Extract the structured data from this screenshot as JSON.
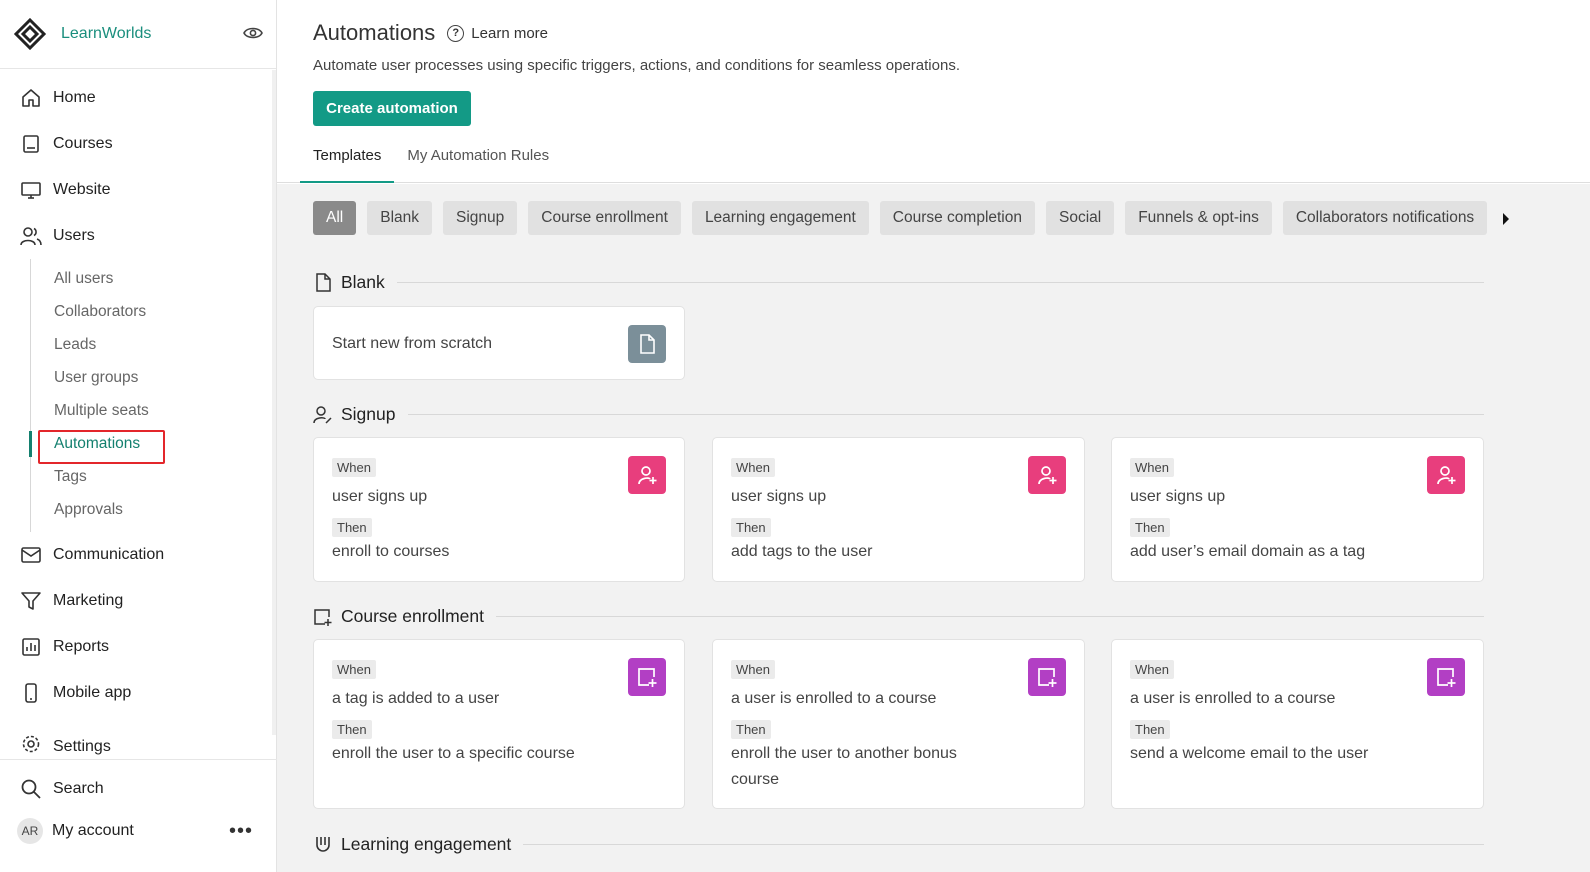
{
  "brand": {
    "name": "LearnWorlds",
    "logo_icon": "logo-icon",
    "view_icon": "eye-icon"
  },
  "nav": {
    "home": "Home",
    "courses": "Courses",
    "website": "Website",
    "users": "Users",
    "user_sub": [
      "All users",
      "Collaborators",
      "Leads",
      "User groups",
      "Multiple seats",
      "Automations",
      "Tags",
      "Approvals"
    ],
    "communication": "Communication",
    "marketing": "Marketing",
    "reports": "Reports",
    "mobile_app": "Mobile app",
    "settings": "Settings"
  },
  "sidebar_bottom": {
    "search": "Search",
    "account": "My account",
    "avatar": "AR",
    "more": "•••"
  },
  "header": {
    "title": "Automations",
    "learn_more": "Learn more",
    "subtitle": "Automate user processes using specific triggers, actions, and conditions for seamless operations.",
    "create_button": "Create automation",
    "tabs": [
      "Templates",
      "My Automation Rules"
    ]
  },
  "filters": [
    "All",
    "Blank",
    "Signup",
    "Course enrollment",
    "Learning engagement",
    "Course completion",
    "Social",
    "Funnels & opt-ins",
    "Collaborators notifications"
  ],
  "sections": {
    "blank": {
      "title": "Blank",
      "card": "Start new from scratch"
    },
    "signup": {
      "title": "Signup",
      "cards": [
        {
          "when": "When",
          "trigger": "user signs up",
          "then": "Then",
          "action": "enroll to courses"
        },
        {
          "when": "When",
          "trigger": "user signs up",
          "then": "Then",
          "action": "add tags to the user"
        },
        {
          "when": "When",
          "trigger": "user signs up",
          "then": "Then",
          "action": "add user’s email domain as a tag"
        }
      ]
    },
    "enrollment": {
      "title": "Course enrollment",
      "cards": [
        {
          "when": "When",
          "trigger": "a tag is added to a user",
          "then": "Then",
          "action": "enroll the user to a specific course"
        },
        {
          "when": "When",
          "trigger": "a user is enrolled to a course",
          "then": "Then",
          "action": "enroll the user to another bonus course"
        },
        {
          "when": "When",
          "trigger": "a user is enrolled to a course",
          "then": "Then",
          "action": "send a welcome email to the user"
        }
      ]
    },
    "engagement": {
      "title": "Learning engagement"
    }
  },
  "colors": {
    "brand": "#139a86",
    "signup_badge": "#e83e7d",
    "enroll_badge": "#b23fc4",
    "blank_badge": "#7b8f99",
    "highlight": "#e3262b"
  }
}
